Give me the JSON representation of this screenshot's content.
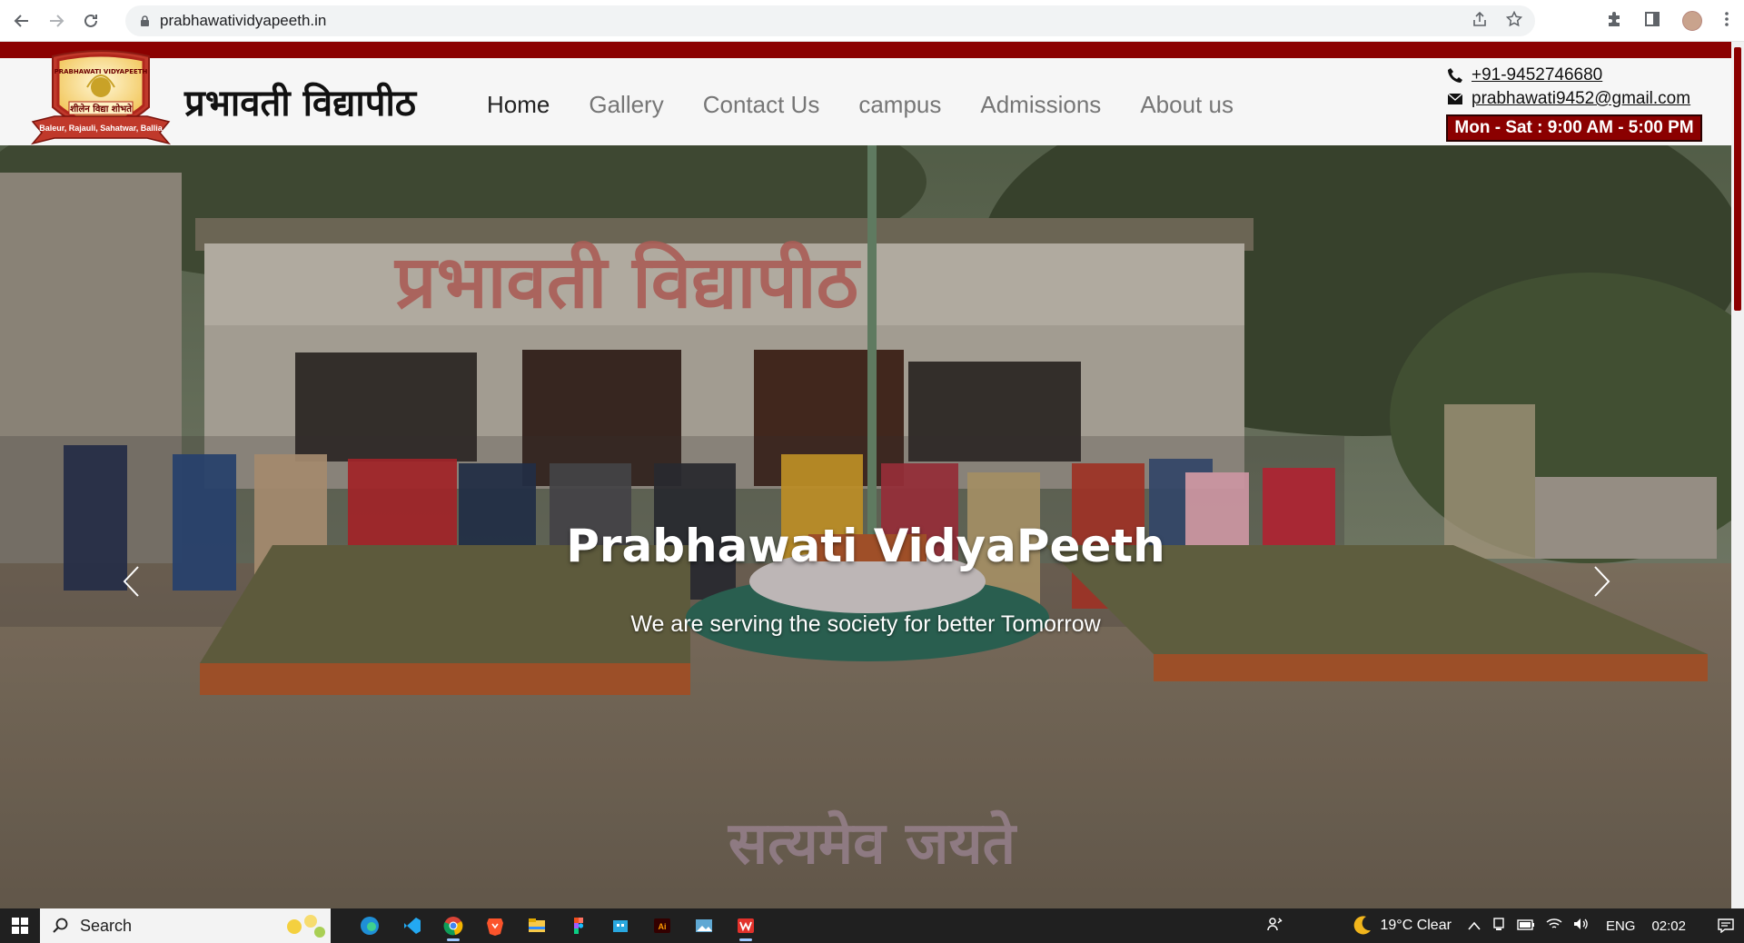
{
  "browser": {
    "url": "prabhawatividyapeeth.in",
    "back_icon": "arrow-left-icon",
    "forward_icon": "arrow-right-icon",
    "reload_icon": "reload-icon"
  },
  "site": {
    "name_hindi": "प्रभावती विद्यापीठ",
    "logo": {
      "top_text": "PRABHAWATI VIDYAPEETH",
      "motto": "शीलेन विद्या शोभते",
      "ribbon": "Baleur, Rajauli, Sahatwar, Ballia"
    },
    "nav": [
      {
        "label": "Home",
        "active": true
      },
      {
        "label": "Gallery",
        "active": false
      },
      {
        "label": "Contact Us",
        "active": false
      },
      {
        "label": "campus",
        "active": false
      },
      {
        "label": "Admissions",
        "active": false
      },
      {
        "label": "About us",
        "active": false
      }
    ],
    "contact": {
      "phone": "+91-9452746680",
      "email": " prabhawati9452@gmail.com",
      "hours": "Mon - Sat : 9:00 AM - 5:00 PM"
    },
    "colors": {
      "brand": "#8b0000",
      "nav_active": "#222222",
      "nav_inactive": "#767676"
    }
  },
  "hero": {
    "title": "Prabhawati VidyaPeeth",
    "subtitle": "We are serving the society for better Tomorrow",
    "building_sign": "प्रभावती विद्यापीठ",
    "ground_text": "सत्यमेव जयते"
  },
  "taskbar": {
    "search_placeholder": "Search",
    "weather": "19°C  Clear",
    "language": "ENG",
    "time": "02:02",
    "apps": [
      "edge-icon",
      "vscode-icon",
      "chrome-icon",
      "brave-icon",
      "file-explorer-icon",
      "figma-icon",
      "store-icon",
      "illustrator-icon",
      "photos-icon",
      "wps-icon"
    ]
  }
}
